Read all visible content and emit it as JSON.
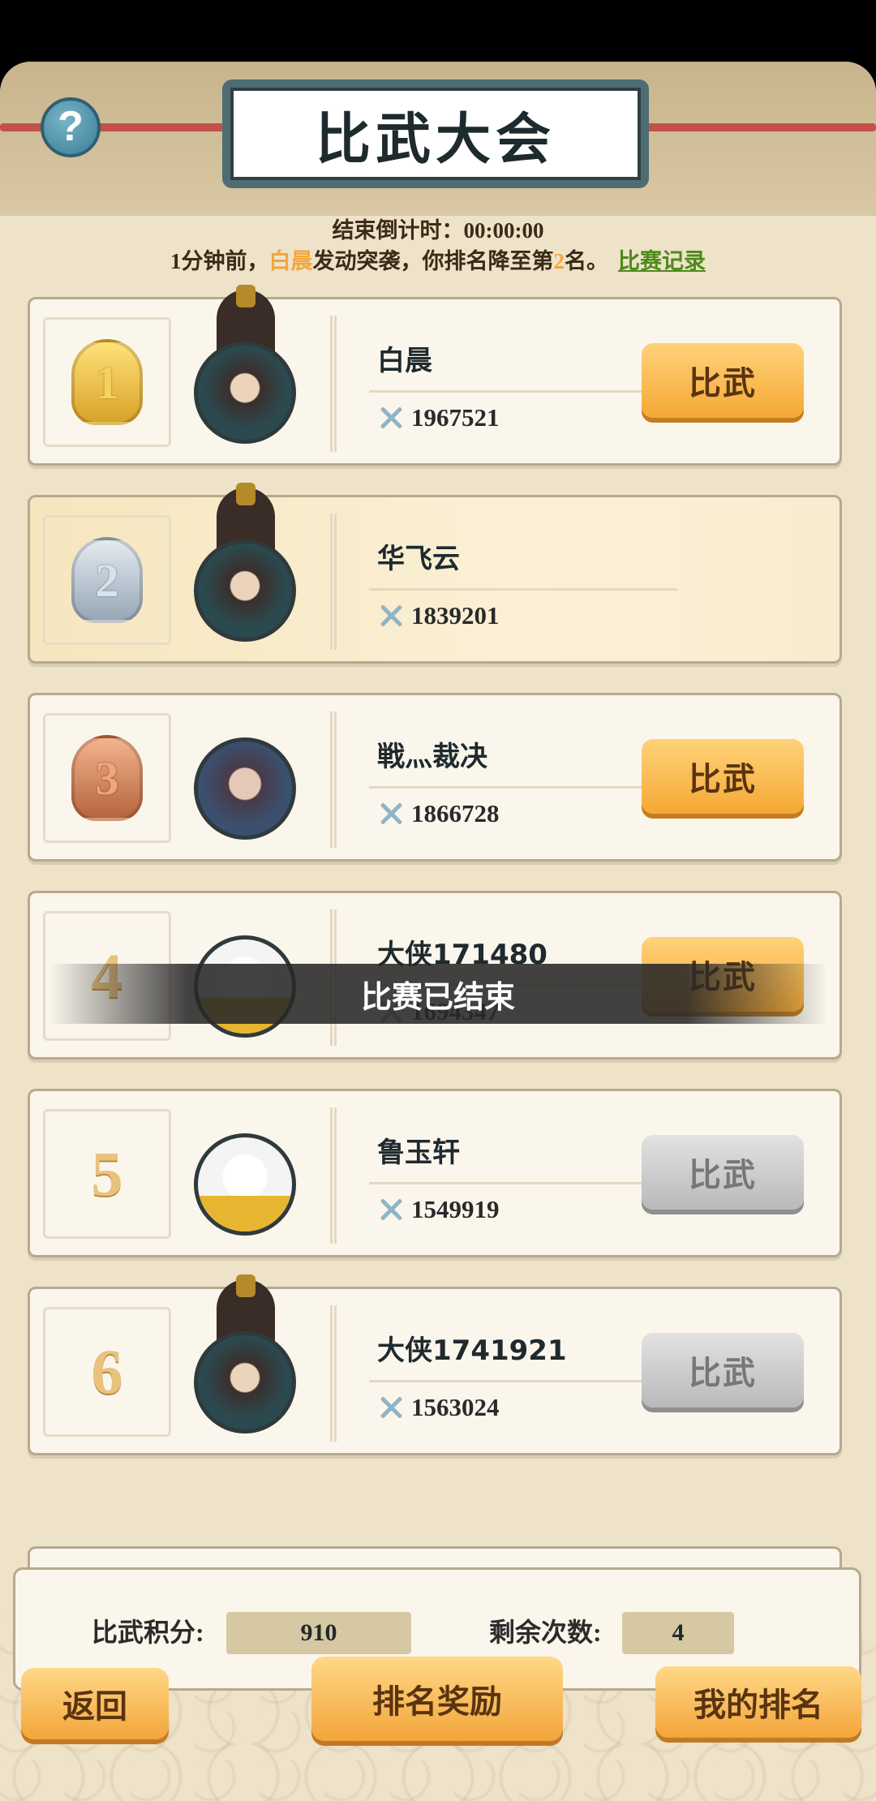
{
  "header": {
    "title": "比武大会",
    "help_icon": "?"
  },
  "countdown": {
    "label": "结束倒计时：",
    "value": "00:00:00"
  },
  "notice": {
    "prefix": "1分钟前，",
    "attacker": "白晨",
    "middle": "发动突袭，你排名降至第",
    "rank": "2",
    "suffix": "名。",
    "record_link": "比赛记录"
  },
  "rankings": [
    {
      "rank": "1",
      "name": "白晨",
      "power": "1967521",
      "button": "比武",
      "badge": "gold",
      "avatar": "male"
    },
    {
      "rank": "2",
      "name": "华飞云",
      "power": "1839201",
      "button": "",
      "badge": "silver",
      "avatar": "male"
    },
    {
      "rank": "3",
      "name": "戦灬裁决",
      "power": "1866728",
      "button": "比武",
      "badge": "bronze",
      "avatar": "female"
    },
    {
      "rank": "4",
      "name": "大侠171480",
      "power": "1694347",
      "button": "比武",
      "badge": "plain",
      "avatar": "panda"
    },
    {
      "rank": "5",
      "name": "鲁玉轩",
      "power": "1549919",
      "button": "比武",
      "badge": "plain",
      "avatar": "panda"
    },
    {
      "rank": "6",
      "name": "大侠1741921",
      "power": "1563024",
      "button": "比武",
      "badge": "plain",
      "avatar": "male"
    }
  ],
  "toast": "比赛已结束",
  "stats": {
    "points_label": "比武积分:",
    "points_value": "910",
    "remaining_label": "剩余次数:",
    "remaining_value": "4"
  },
  "bottom": {
    "back": "返回",
    "rewards": "排名奖励",
    "my_rank": "我的排名"
  },
  "colors": {
    "accent_orange": "#f5a834",
    "highlight": "#f3a63a",
    "link_green": "#4e8a1c",
    "disabled_gray": "#b9b9b9"
  }
}
